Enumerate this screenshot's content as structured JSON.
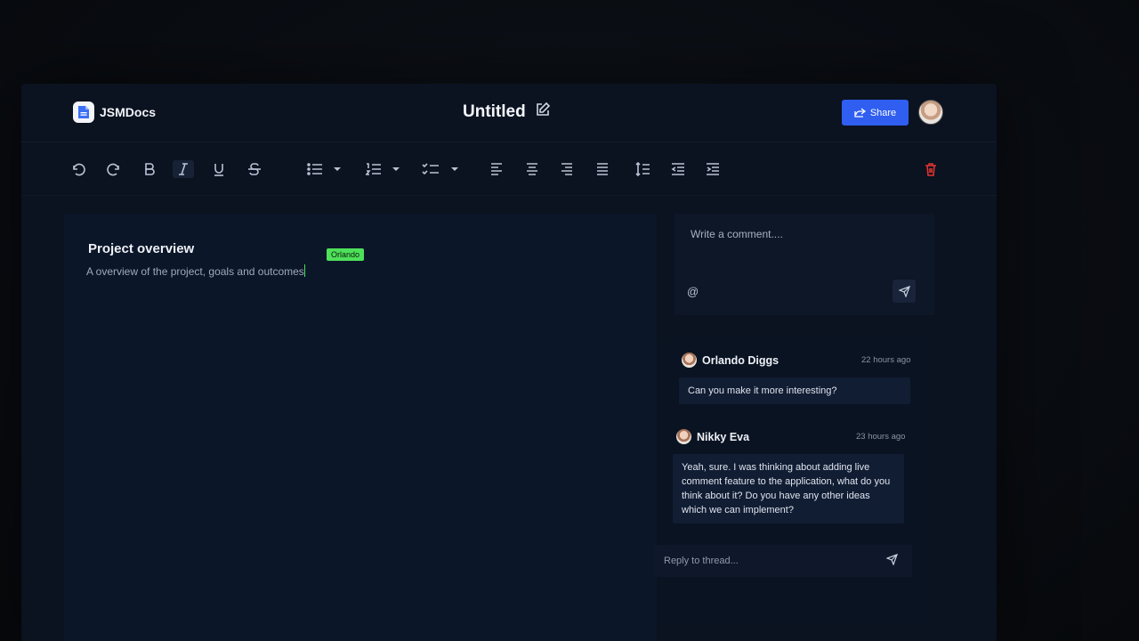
{
  "header": {
    "app_name": "JSMDocs",
    "doc_title": "Untitled",
    "share_label": "Share",
    "accent_color": "#2f5ef0"
  },
  "toolbar": {
    "items": [
      "undo-icon",
      "redo-icon",
      "bold-icon",
      "italic-icon",
      "underline-icon",
      "strikethrough-icon",
      "bullet-list-icon",
      "ordered-list-icon",
      "checklist-icon",
      "align-left-icon",
      "align-center-icon",
      "align-right-icon",
      "align-justify-icon",
      "line-height-icon",
      "outdent-icon",
      "indent-icon",
      "delete-icon"
    ],
    "active": "italic-icon",
    "delete_color": "#e0342f"
  },
  "editor": {
    "heading": "Project overview",
    "paragraph": "A overview of the project, goals and outcomes",
    "cursor_user": "Orlando",
    "cursor_color": "#4ee05a"
  },
  "composer": {
    "placeholder": "Write a comment....",
    "mention_symbol": "@"
  },
  "thread": {
    "comments": [
      {
        "author": "Orlando Diggs",
        "time": "22 hours ago",
        "text": "Can you make it more interesting?"
      },
      {
        "author": "Nikky Eva",
        "time": "23 hours ago",
        "text": "Yeah, sure. I was thinking about adding live comment feature to the application, what do you think about it? Do you have any other ideas which we can implement?"
      }
    ],
    "reply_placeholder": "Reply to thread..."
  }
}
